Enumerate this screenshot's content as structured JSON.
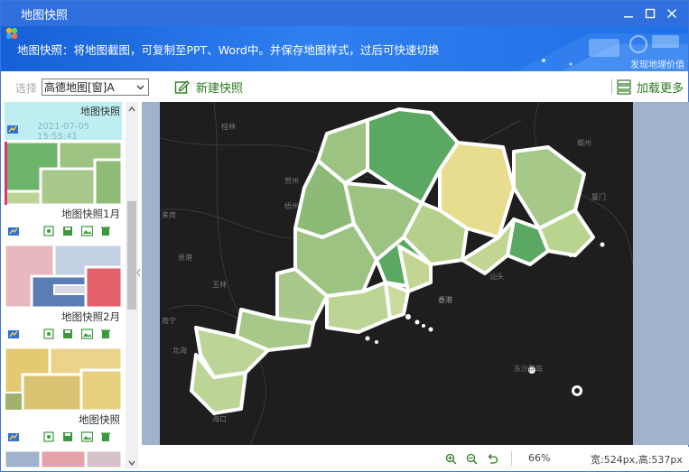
{
  "window": {
    "title": "地图快照"
  },
  "banner": {
    "description": "地图快照：将地图截图，可复制至PPT、Word中。并保存地图样式，过后可快速切换",
    "discover_link": "发现地理价值"
  },
  "toolbar": {
    "select_label": "选择",
    "select_value": "高德地图[窗]A",
    "new_snapshot": "新建快照",
    "load_more": "加载更多"
  },
  "snapshots": [
    {
      "name": "地图快照",
      "timestamp": "2021-07-05 15:55:41"
    },
    {
      "name": "地图快照1月"
    },
    {
      "name": "地图快照2月"
    },
    {
      "name": "地图快照"
    }
  ],
  "map": {
    "labels": [
      "桂林",
      "贺州",
      "梧州",
      "来宾",
      "贵港",
      "玉林",
      "南宁",
      "北海",
      "赣州",
      "厦门",
      "香港",
      "汕头",
      "东沙群岛",
      "海口"
    ]
  },
  "status": {
    "zoom": "66%",
    "dimensions": "宽:524px,高:537px"
  },
  "colors": {
    "titlebar": "#2f6fde",
    "accent_green": "#2b7a1f",
    "map_bg": "#1e1e1e",
    "region_dark_green": "#5aa862",
    "region_light_green": "#9dc383",
    "region_yellow": "#e8dc8f"
  }
}
